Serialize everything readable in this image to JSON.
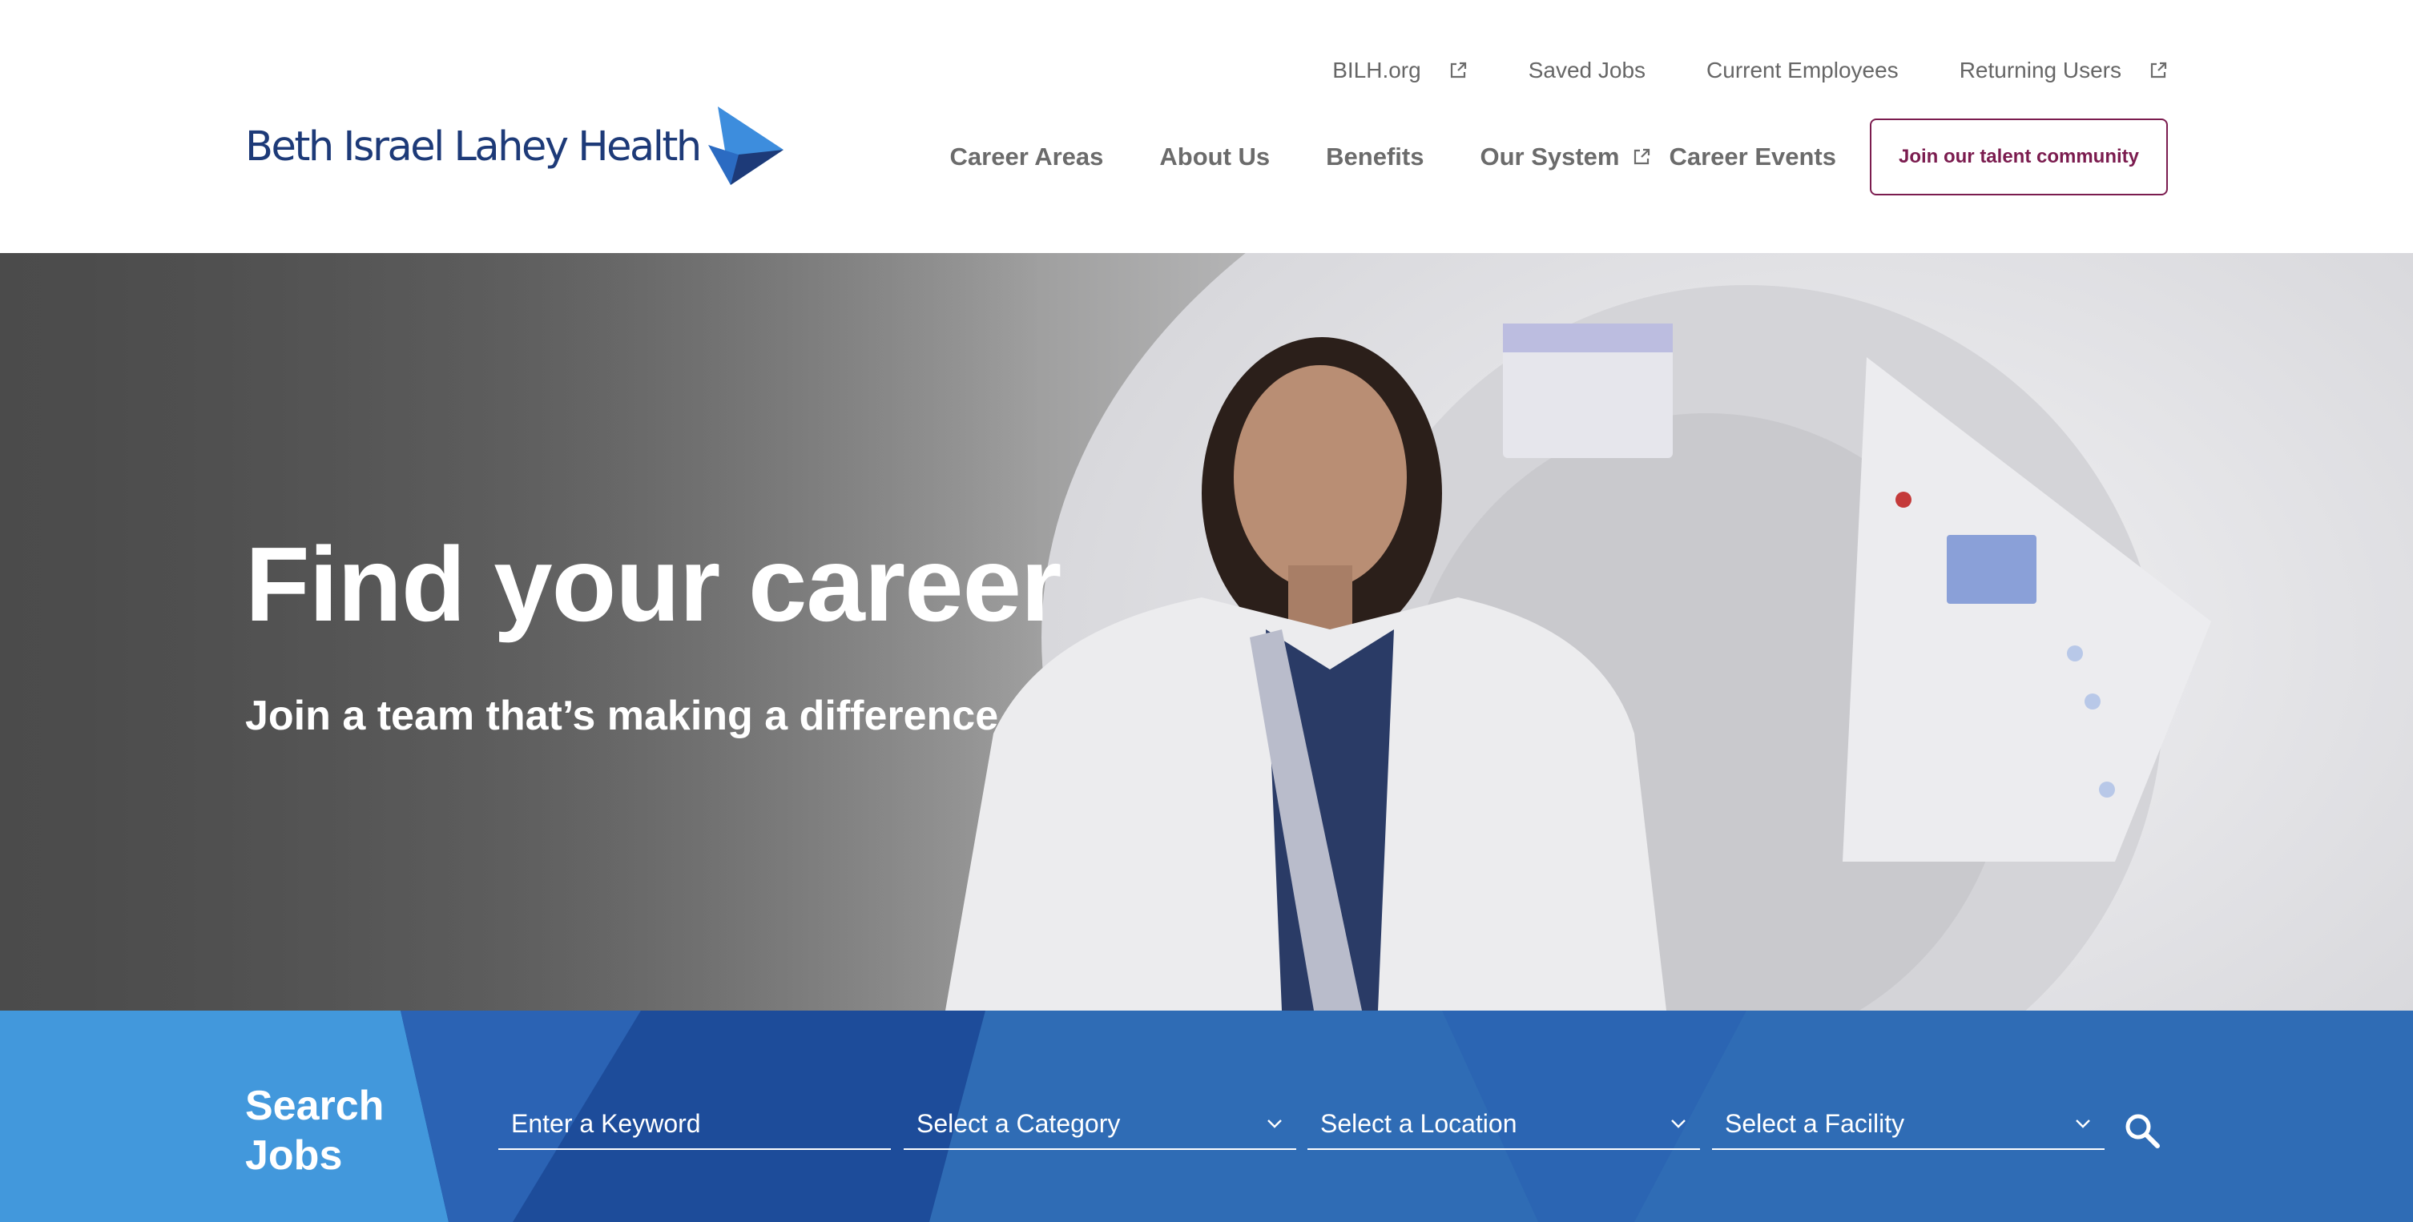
{
  "brand": {
    "name": "Beth Israel Lahey Health",
    "logo_icon": "bird-logo-icon",
    "colors": {
      "navy": "#1d3a78",
      "accent_blue": "#3d8ddd",
      "maroon": "#7b1c4f",
      "search_blue": "#2f6cb5"
    }
  },
  "utility_nav": {
    "items": [
      {
        "label": "BILH.org",
        "icon": "external-link-icon"
      },
      {
        "label": "Saved Jobs"
      },
      {
        "label": "Current Employees"
      },
      {
        "label": "Returning Users",
        "icon": "external-link-icon"
      }
    ]
  },
  "main_nav": {
    "items": [
      {
        "label": "Career Areas"
      },
      {
        "label": "About Us"
      },
      {
        "label": "Benefits"
      },
      {
        "label": "Our System",
        "icon": "external-link-icon"
      },
      {
        "label": "Career Events"
      }
    ],
    "cta_label": "Join our talent community"
  },
  "hero": {
    "title": "Find your career",
    "subtitle": "Join a team that’s making a difference"
  },
  "search": {
    "title": "Search Jobs",
    "keyword_placeholder": "Enter a Keyword",
    "category_label": "Select a Category",
    "location_label": "Select a Location",
    "facility_label": "Select a Facility",
    "dropdown_icon": "chevron-down-icon",
    "submit_icon": "search-icon"
  }
}
